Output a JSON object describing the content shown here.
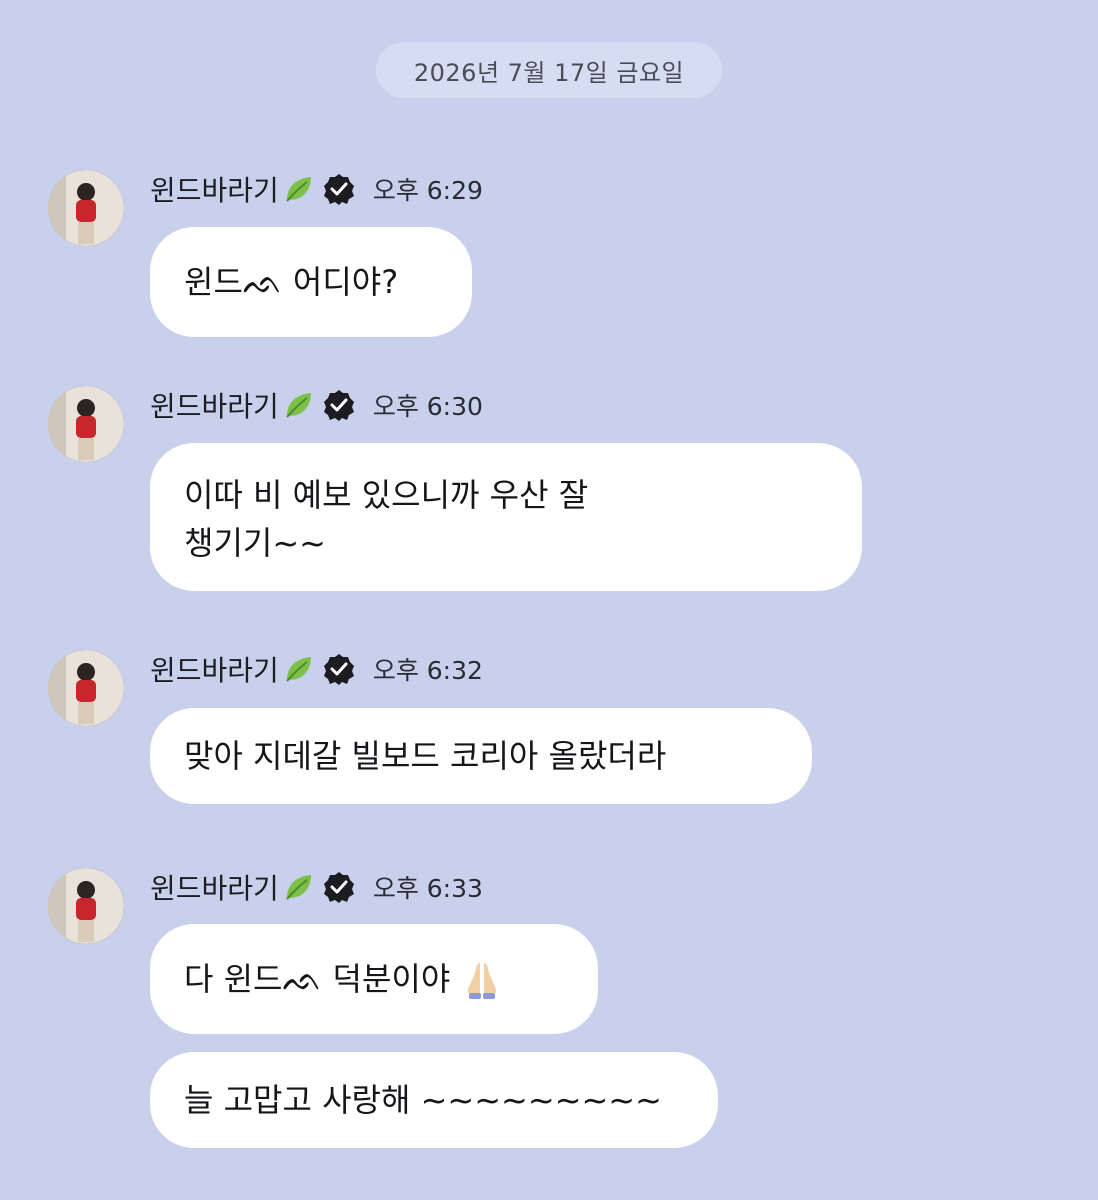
{
  "date_divider": "2026년 7월 17일 금요일",
  "colors": {
    "background": "#c8d0ec",
    "bubble": "#ffffff",
    "date_pill": "#d6dcf1",
    "leaf": "#7cc04a",
    "verified": "#1c1c22"
  },
  "messages": [
    {
      "sender": "윈드바라기",
      "time": "오후 6:29",
      "bubbles": [
        "윈드ᨒ 어디야?"
      ]
    },
    {
      "sender": "윈드바라기",
      "time": "오후 6:30",
      "bubbles": [
        "이따 비 예보 있으니까 우산 잘\n챙기기~~"
      ]
    },
    {
      "sender": "윈드바라기",
      "time": "오후 6:32",
      "bubbles": [
        "맞아 지데갈 빌보드 코리아 올랐더라"
      ]
    },
    {
      "sender": "윈드바라기",
      "time": "오후 6:33",
      "bubbles": [
        "다 윈드ᨒ 덕분이야",
        "늘 고맙고 사랑해 ~~~~~~~~~"
      ]
    }
  ],
  "icons": {
    "leaf": "leaf-icon",
    "verified": "verified-badge-icon",
    "pray": "folded-hands-icon"
  }
}
